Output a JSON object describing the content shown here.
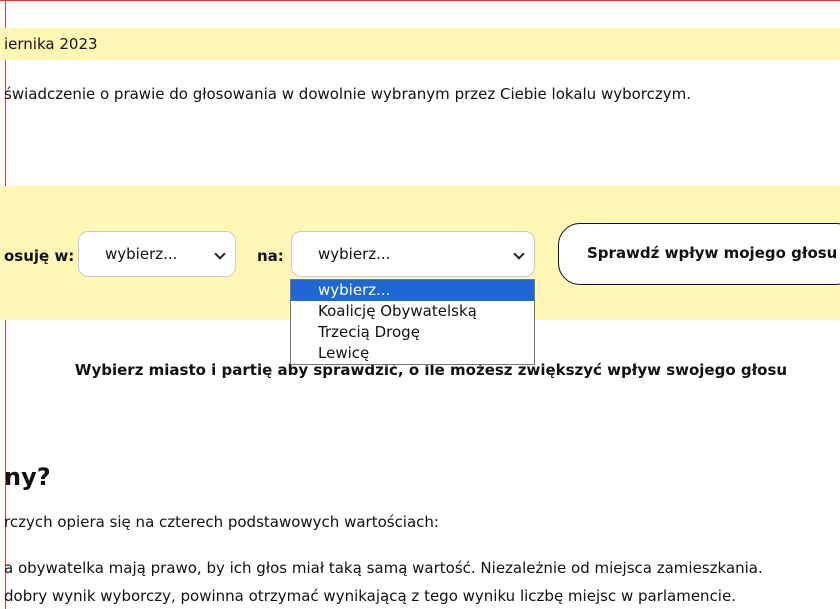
{
  "banner": {
    "date_text": "iernika 2023"
  },
  "intro": {
    "text": "świadczenie o prawie do głosowania w dowolnie wybranym przez Ciebie lokalu wyborczym."
  },
  "vote_form": {
    "city_label": "osuję w:",
    "city_select": {
      "value": "wybierz..."
    },
    "party_label": "na:",
    "party_select": {
      "value": "wybierz..."
    },
    "party_options": [
      "wybierz...",
      "Koalicję Obywatelską",
      "Trzecią Drogę",
      "Lewicę"
    ],
    "selected_option": "wybierz...",
    "submit_label": "Sprawdź wpływ mojego głosu"
  },
  "hint": "Wybierz miasto i partię aby sprawdzić, o ile możesz zwiększyć wpływ swojego głosu",
  "section": {
    "heading": "ny?",
    "paragraphs": [
      "rczych opiera się na czterech podstawowych wartościach:",
      "a obywatelka mają prawo, by ich głos miał taką samą wartość. Niezależnie od miejsca zamieszkania.",
      "dobry wynik wyborczy, powinna otrzymać wynikającą z tego wyniku liczbę miejsc w parlamencie."
    ]
  },
  "colors": {
    "highlight_background": "#fff7b3",
    "selected_option_background": "#1f67d3",
    "page_border": "#e53935"
  }
}
